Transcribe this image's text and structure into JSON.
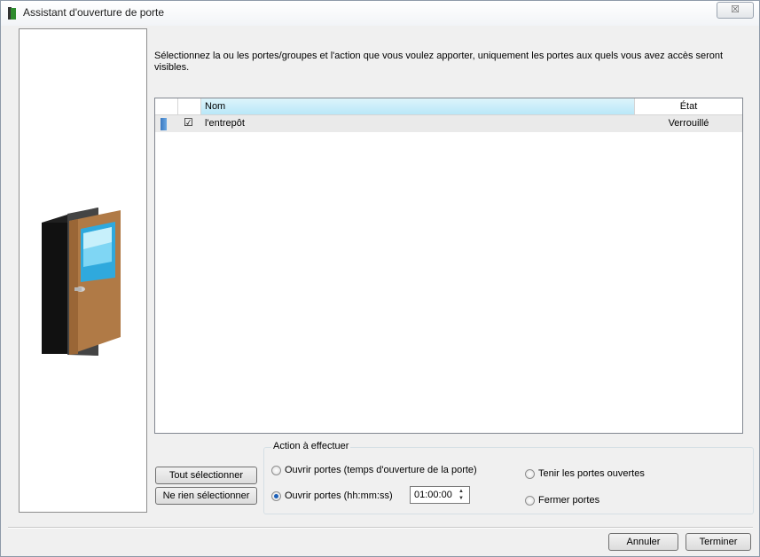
{
  "window": {
    "title": "Assistant d'ouverture de porte",
    "close_glyph": "☒"
  },
  "instruction": "Sélectionnez la ou les portes/groupes  et l'action que vous voulez apporter, uniquement les portes aux quels vous avez accès seront visibles.",
  "table": {
    "columns": [
      "Nom",
      "État"
    ],
    "rows": [
      {
        "checked_glyph": "☑",
        "nom": "l'entrepôt",
        "etat": "Verrouillé"
      }
    ]
  },
  "buttons": {
    "select_all": "Tout sélectionner",
    "select_none": "Ne rien sélectionner",
    "cancel": "Annuler",
    "finish": "Terminer"
  },
  "action_group": {
    "legend": "Action à effectuer",
    "options": [
      {
        "label": "Ouvrir portes (temps d'ouverture de la porte)",
        "selected": false
      },
      {
        "label": "Ouvrir portes (hh:mm:ss)",
        "selected": true
      },
      {
        "label": "Tenir les portes ouvertes",
        "selected": false
      },
      {
        "label": "Fermer portes",
        "selected": false
      }
    ],
    "time_value": "01:00:00"
  },
  "icons": {
    "title_icon": "door-app-icon",
    "illustration": "door-illustration",
    "spin_up": "▲",
    "spin_down": "▼"
  }
}
